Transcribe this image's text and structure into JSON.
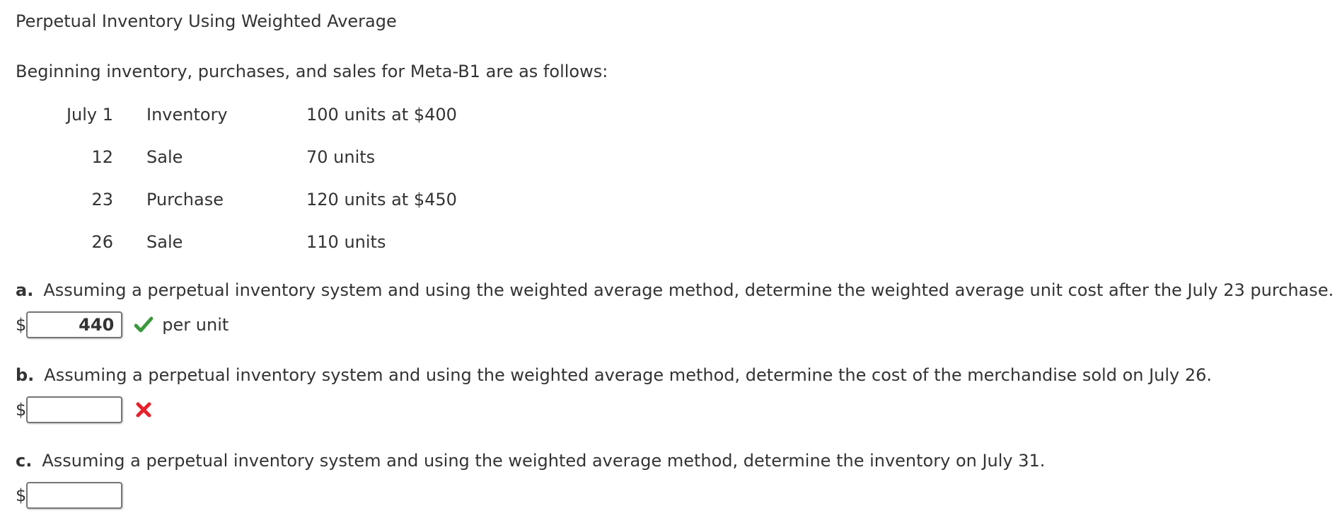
{
  "title": "Perpetual Inventory Using Weighted Average",
  "intro": "Beginning inventory, purchases, and sales for Meta-B1 are as follows:",
  "inventory_table": {
    "rows": [
      {
        "date": "July 1",
        "type": "Inventory",
        "detail": "100 units at $400"
      },
      {
        "date": "12",
        "type": "Sale",
        "detail": "70 units"
      },
      {
        "date": "23",
        "type": "Purchase",
        "detail": "120 units at $450"
      },
      {
        "date": "26",
        "type": "Sale",
        "detail": "110 units"
      }
    ]
  },
  "questions": [
    {
      "letter": "a.",
      "text": "Assuming a perpetual inventory system and using the weighted average method, determine the weighted average unit cost after the July 23 purchase.",
      "currency_symbol": "$",
      "answer_value": "440",
      "status": "correct",
      "status_icon": "checkmark-icon",
      "status_color": "#3a9a3a",
      "unit_label": "per unit"
    },
    {
      "letter": "b.",
      "text": "Assuming a perpetual inventory system and using the weighted average method, determine the cost of the merchandise sold on July 26.",
      "currency_symbol": "$",
      "answer_value": "",
      "status": "incorrect",
      "status_icon": "x-mark-icon",
      "status_color": "#e8202a"
    },
    {
      "letter": "c.",
      "text": "Assuming a perpetual inventory system and using the weighted average method, determine the inventory on July 31.",
      "currency_symbol": "$",
      "answer_value": ""
    }
  ]
}
